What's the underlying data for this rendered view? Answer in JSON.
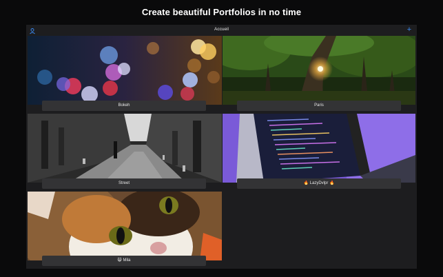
{
  "headline": "Create beautiful Portfolios in no time",
  "app": {
    "title": "Accueil",
    "left_icon": "user-icon",
    "right_icon": "plus-icon",
    "add_glyph": "+",
    "accent": "#3a8df8"
  },
  "tiles": [
    {
      "name": "Bokeh"
    },
    {
      "name": "Paris"
    },
    {
      "name": "Street"
    },
    {
      "name": "🔥 LazyDvlpr 🔥"
    },
    {
      "name": "😺 Mila"
    }
  ]
}
